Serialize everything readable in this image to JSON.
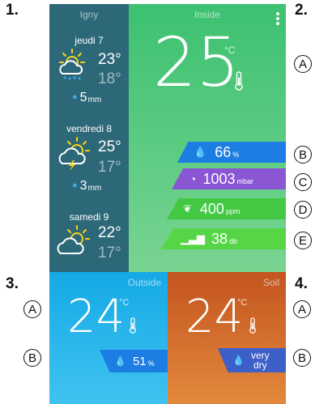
{
  "labels": {
    "n1": "1.",
    "n2": "2.",
    "n3": "3.",
    "n4": "4.",
    "a": "A",
    "b": "B",
    "c": "C",
    "d": "D",
    "e": "E"
  },
  "forecast": {
    "location": "Igny",
    "days": [
      {
        "day": "jeudi 7",
        "hi": "23°",
        "lo": "18°",
        "rain": "5",
        "rain_unit": "mm",
        "icon": "sun-cloud-rain-icon"
      },
      {
        "day": "vendredi 8",
        "hi": "25°",
        "lo": "17°",
        "rain": "3",
        "rain_unit": "mm",
        "icon": "sun-cloud-storm-icon"
      },
      {
        "day": "samedi 9",
        "hi": "22°",
        "lo": "17°",
        "icon": "sun-cloud-icon"
      }
    ]
  },
  "inside": {
    "title": "Inside",
    "temp": "25",
    "unit": "°C",
    "humidity": {
      "value": "66",
      "unit": "%"
    },
    "pressure": {
      "value": "1003",
      "unit": "mbar"
    },
    "co2": {
      "value": "400",
      "unit": "ppm"
    },
    "noise": {
      "value": "38",
      "unit": "db"
    }
  },
  "outside": {
    "title": "Outside",
    "temp": "24",
    "unit": "°C",
    "humidity": {
      "value": "51",
      "unit": "%"
    }
  },
  "soil": {
    "title": "Soil",
    "temp": "24",
    "unit": "°C",
    "moisture": "very dry",
    "moisture_lines": [
      "very",
      "dry"
    ]
  },
  "colors": {
    "forecast_bg": "#2d6878",
    "inside_top": "#3cc171",
    "inside_bottom": "#79d491",
    "outside_top": "#15a9e6",
    "outside_bottom": "#3fc3f0",
    "soil_top": "#c3541e",
    "soil_bottom": "#e3893d",
    "humidity": "#1c7de3",
    "pressure": "#8a56d3",
    "co2": "#42c843",
    "noise": "#56d646"
  }
}
